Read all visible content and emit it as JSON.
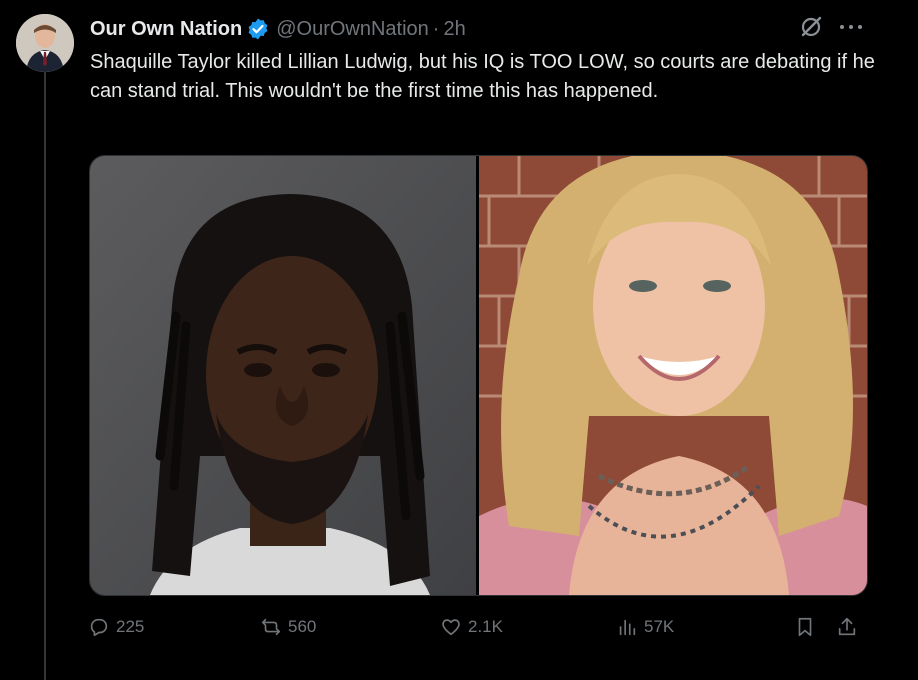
{
  "tweet": {
    "author_name": "Our Own Nation",
    "handle": "@OurOwnNation",
    "separator": "·",
    "time": "2h",
    "text": "Shaquille Taylor killed Lillian Ludwig, but his IQ is TOO LOW, so courts are debating if he can stand trial. This wouldn't be the first time this has happened."
  },
  "icons": {
    "verified": "verified-badge-icon",
    "grok": "grok-icon",
    "more": "more-icon",
    "reply": "reply-icon",
    "retweet": "retweet-icon",
    "like": "like-icon",
    "views": "views-icon",
    "bookmark": "bookmark-icon",
    "share": "share-icon"
  },
  "metrics": {
    "replies": "225",
    "retweets": "560",
    "likes": "2.1K",
    "views": "57K"
  },
  "colors": {
    "background": "#000000",
    "text_primary": "#e7e9ea",
    "text_secondary": "#71767b",
    "verified_blue": "#1d9bf0",
    "thread_line": "#333639"
  }
}
